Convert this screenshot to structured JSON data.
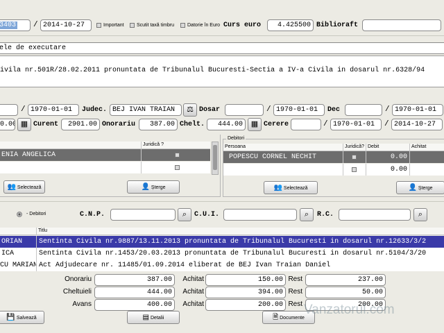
{
  "header": {
    "nr": "3403",
    "date": "2014-10-27",
    "important_label": "Important",
    "scutit_label": "Scutit taxă timbru",
    "datorie_label": "Datorie în Euro",
    "curs_euro_label": "Curs euro",
    "curs_euro_value": "4.425500",
    "biblioraft_label": "Biblioraft",
    "biblioraft_value": ""
  },
  "titlu_section": {
    "label": "ele de executare",
    "text": "ivila nr.501R/28.02.2011 pronuntata de Tribunalul Bucuresti-Sectia a IV-a Civila in dosarul nr.6328/94"
  },
  "row1": {
    "date1": "1970-01-01",
    "judec_label": "Judec.",
    "judec_value": "BEJ IVAN TRAIAN",
    "dosar_label": "Dosar",
    "dosar_value": "",
    "date2": "1970-01-01",
    "dec_label": "Dec",
    "dec_value": "",
    "date3": "1970-01-01"
  },
  "row2": {
    "val_left": "0.00",
    "curent_label": "Curent",
    "curent_value": "2901.00",
    "onorariu_label": "Onorariu",
    "onorariu_value": "387.00",
    "chelt_label": "Chelt.",
    "chelt_value": "444.00",
    "cerere_label": "Cerere",
    "cerere_value": "",
    "date1": "1970-01-01",
    "date2": "2014-10-27"
  },
  "creditori": {
    "col_juridica": "Juridică ?",
    "rows": [
      {
        "name": "ENIA ANGELICA"
      },
      {
        "name": ""
      }
    ],
    "select_label": "Selectează",
    "delete_label": "Șterge"
  },
  "debitori": {
    "title": "Debitori",
    "col_persoana": "Persoana",
    "col_juridica": "Juridică?",
    "col_debit": "Debit",
    "col_achitat": "Achitat",
    "rows": [
      {
        "name": "POPESCU CORNEL NECHIT",
        "debit": "0.00"
      },
      {
        "name": "",
        "debit": "0.00"
      }
    ],
    "select_label": "Selectează",
    "delete_label": "Șterge"
  },
  "search": {
    "debitori_label": "- Debitori",
    "cnp_label": "C.N.P.",
    "cui_label": "C.U.I.",
    "rc_label": "R.C."
  },
  "list": {
    "col_titlu": "Titlu",
    "rows": [
      {
        "name": "ORIAN",
        "titlu": "Sentinta Civila nr.9887/13.11.2013 pronuntata de Tribunalul Bucuresti in dosarul nr.12633/3/2"
      },
      {
        "name": "ICA",
        "titlu": "Sentinta Civila nr.1453/20.03.2013 pronuntata de Tribunalul Bucuresti in dosarul nr.5104/3/20"
      },
      {
        "name": "CU MARIAN",
        "titlu": "Act Adjudecare nr. 11485/01.09.2014 eliberat de BEJ Ivan Traian Daniel"
      }
    ]
  },
  "totals": {
    "onorariu_label": "Onorariu",
    "onorariu": "387.00",
    "cheltuieli_label": "Cheltuieli",
    "cheltuieli": "444.00",
    "avans_label": "Avans",
    "avans": "400.00",
    "achitat_label": "Achitat",
    "achitat1": "150.00",
    "achitat2": "394.00",
    "achitat3": "200.00",
    "rest_label": "Rest",
    "rest1": "237.00",
    "rest2": "50.00",
    "rest3": "200.00"
  },
  "footer": {
    "save_label": "Salvează",
    "details_label": "Detalii",
    "documents_label": "Documente",
    "watermark": "Vanzatorul.com"
  }
}
